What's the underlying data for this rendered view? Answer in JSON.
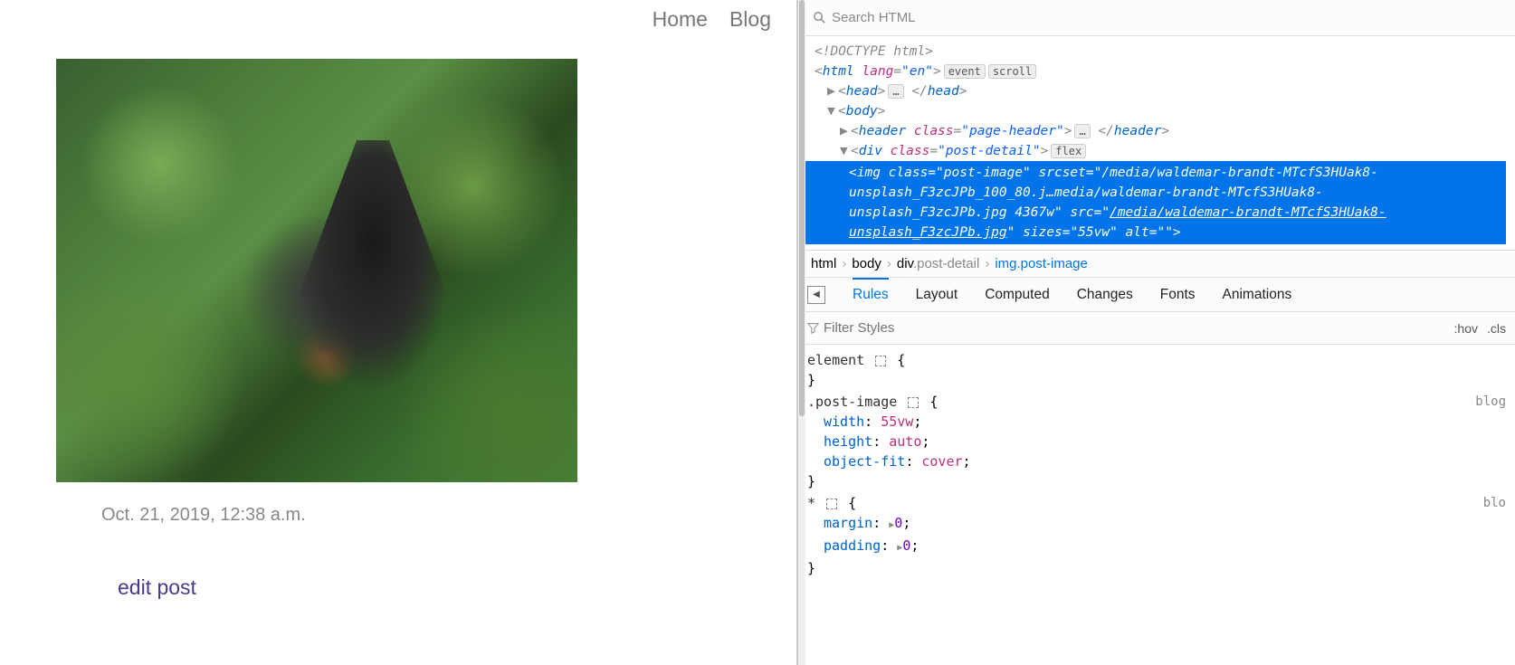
{
  "page": {
    "nav": {
      "home": "Home",
      "blog": "Blog"
    },
    "date": "Oct. 21, 2019, 12:38 a.m.",
    "edit": "edit post"
  },
  "dev": {
    "search_placeholder": "Search HTML",
    "tree": {
      "doctype": "<!DOCTYPE html>",
      "html_open": "html",
      "lang_attr": "lang",
      "lang_val": "\"en\"",
      "badge_event": "event",
      "badge_scroll": "scroll",
      "head": "head",
      "ellipsis": "…",
      "body": "body",
      "header": "header",
      "class_attr": "class",
      "header_class": "\"page-header\"",
      "div": "div",
      "div_class": "\"post-detail\"",
      "badge_flex": "flex",
      "sel_l1": "<img class=\"post-image\" srcset=\"/media/waldemar-brandt-MTcfS3HUak8-",
      "sel_l2": "unsplash_F3zcJPb_100_80.j…media/waldemar-brandt-MTcfS3HUak8-",
      "sel_l3a": "unsplash_F3zcJPb.jpg 4367w\" src=\"",
      "sel_l3b": "/media/waldemar-brandt-MTcfS3HUak8-",
      "sel_l4a": "unsplash_F3zcJPb.jpg",
      "sel_l4b": "\" sizes=\"55vw\" alt=\"\">"
    },
    "crumbs": [
      "html",
      "body",
      "div",
      ".post-detail",
      "img",
      ".post-image"
    ],
    "tabs": [
      "Rules",
      "Layout",
      "Computed",
      "Changes",
      "Fonts",
      "Animations"
    ],
    "filter_placeholder": "Filter Styles",
    "hov": ":hov",
    "cls": ".cls",
    "rules": {
      "elem": "element",
      "postimg_sel": ".post-image",
      "postimg_src": "blog",
      "postimg": [
        {
          "k": "width",
          "v": "55vw"
        },
        {
          "k": "height",
          "v": "auto"
        },
        {
          "k": "object-fit",
          "v": "cover"
        }
      ],
      "star_sel": "*",
      "star_src": "blo",
      "star": [
        {
          "k": "margin",
          "v": "0"
        },
        {
          "k": "padding",
          "v": "0"
        }
      ]
    }
  }
}
